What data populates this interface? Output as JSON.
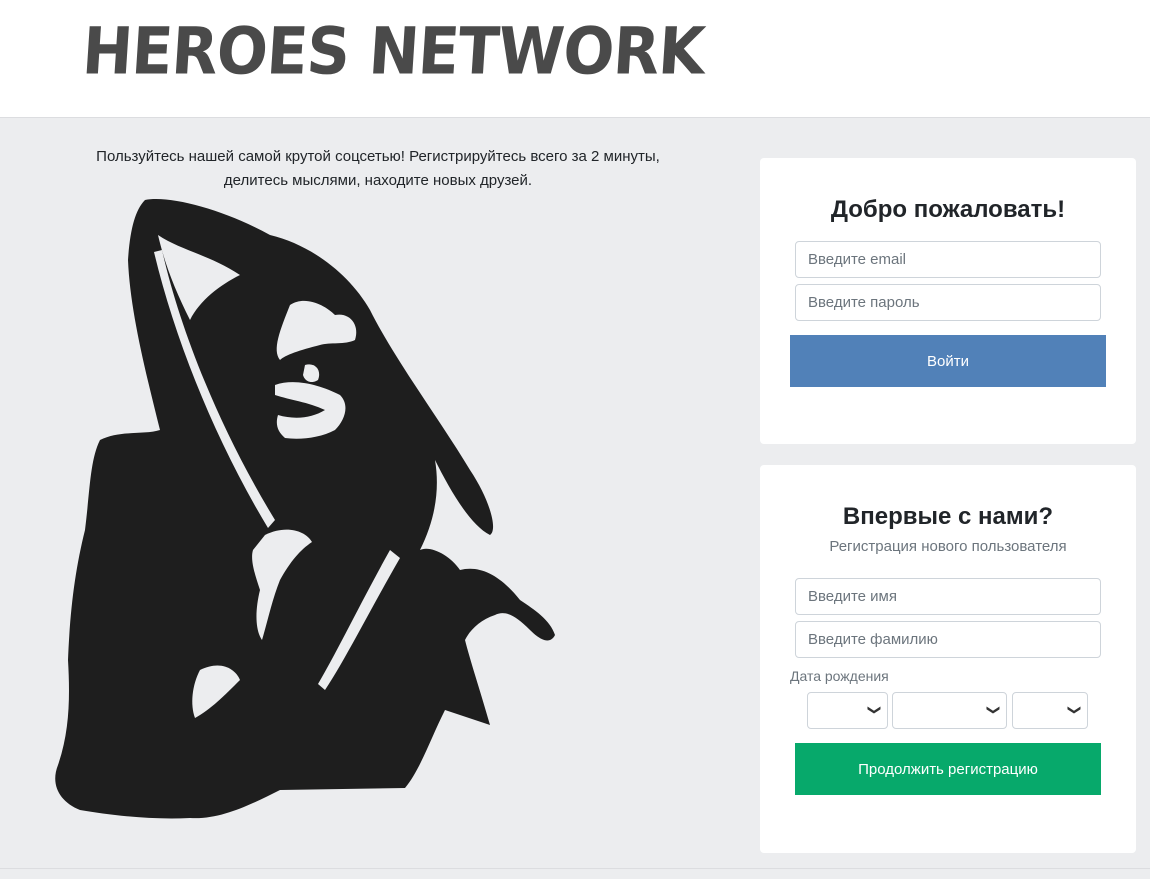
{
  "brand": {
    "logo_text": "HEROES NETWORK"
  },
  "intro": {
    "line1": "Пользуйтесь нашей самой крутой соцсетью! Регистрируйтесь всего за 2 минуты,",
    "line2": "делитесь мыслями, находите новых друзей."
  },
  "illustration": {
    "icon": "grim-reaper-icon"
  },
  "login": {
    "title": "Добро пожаловать!",
    "email_placeholder": "Введите email",
    "password_placeholder": "Введите пароль",
    "submit_label": "Войти"
  },
  "register": {
    "title": "Впервые с нами?",
    "subtitle": "Регистрация нового пользователя",
    "first_name_placeholder": "Введите имя",
    "last_name_placeholder": "Введите фамилию",
    "dob_label": "Дата рождения",
    "day_value": "",
    "month_value": "",
    "year_value": "",
    "submit_label": "Продолжить регистрацию"
  },
  "colors": {
    "primary_button": "#5181b8",
    "success_button": "#07a96b",
    "page_background": "#ecedef"
  }
}
